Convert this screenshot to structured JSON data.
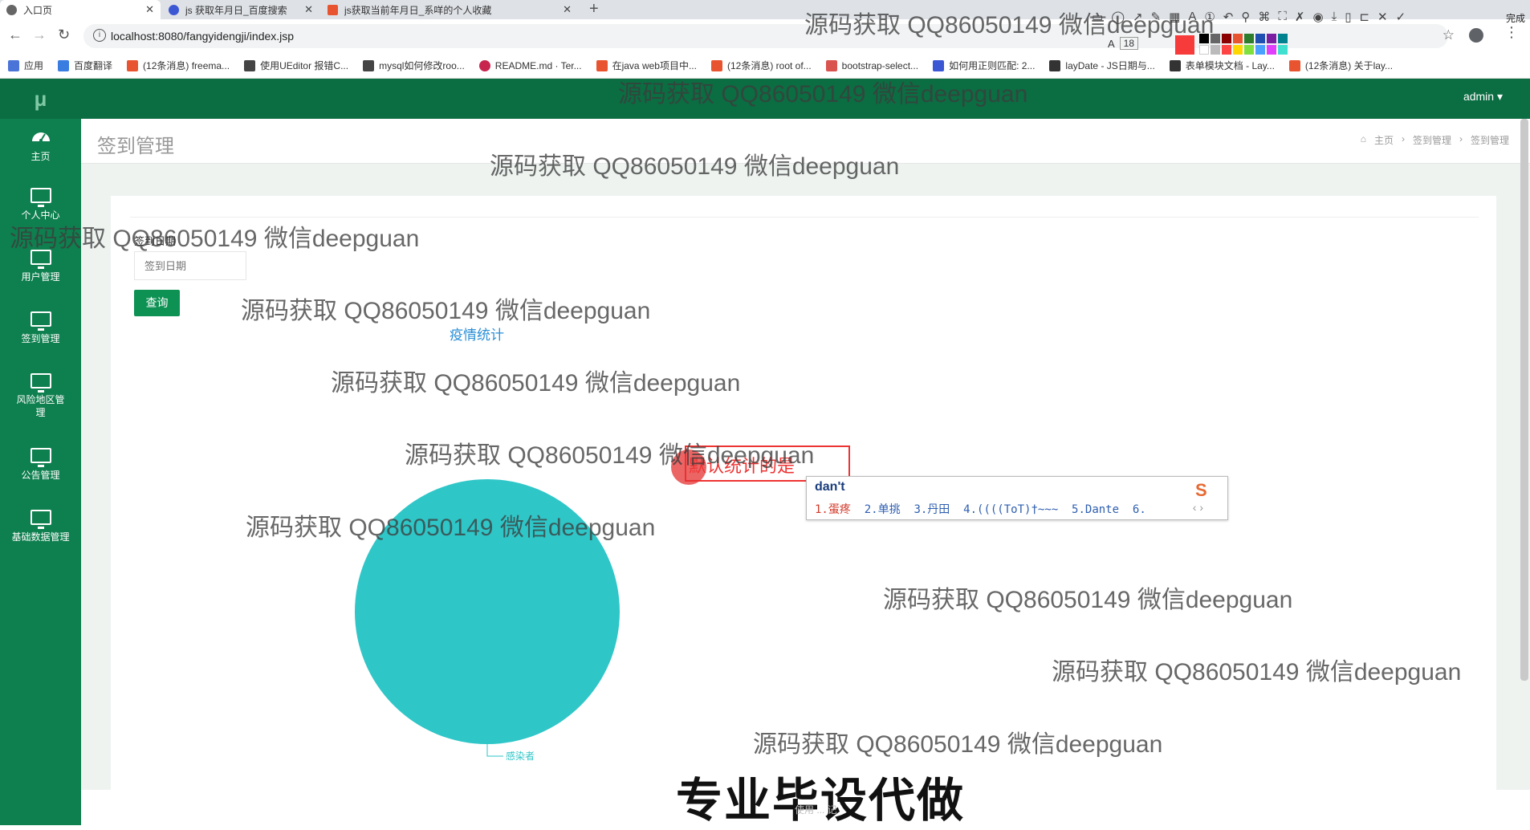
{
  "browser": {
    "tabs": [
      {
        "title": "入口页",
        "active": true
      },
      {
        "title": "js 获取年月日_百度搜索",
        "active": false
      },
      {
        "title": "js获取当前年月日_系咩的个人收藏",
        "active": false
      }
    ],
    "url": "localhost:8080/fangyidengji/index.jsp",
    "bookmarks": [
      "应用",
      "百度翻译",
      "(12条消息) freema...",
      "使用UEditor 报错C...",
      "mysql如何修改roo...",
      "README.md · Ter...",
      "在java web项目中...",
      "(12条消息) root of...",
      "bootstrap-select...",
      "如何用正则匹配: 2...",
      "layDate - JS日期与...",
      "表单模块文档 - Lay...",
      "(12条消息) 关于lay..."
    ],
    "annotation_toolbar": {
      "done_label": "完成",
      "font_size": "18",
      "current_color": "#f73a3a"
    }
  },
  "app": {
    "logo": "μ",
    "admin": "admin ▾",
    "sidebar": [
      {
        "label": "主页",
        "icon": "dashboard-icon"
      },
      {
        "label": "个人中心",
        "icon": "monitor-icon"
      },
      {
        "label": "用户管理",
        "icon": "monitor-icon"
      },
      {
        "label": "签到管理",
        "icon": "monitor-icon"
      },
      {
        "label": "风险地区管理",
        "icon": "monitor-icon"
      },
      {
        "label": "公告管理",
        "icon": "monitor-icon"
      },
      {
        "label": "基础数据管理",
        "icon": "monitor-icon"
      }
    ],
    "page_title": "签到管理",
    "breadcrumb": [
      "主页",
      "签到管理",
      "签到管理"
    ],
    "search": {
      "label": "签到日期",
      "placeholder": "签到日期",
      "button": "查询"
    },
    "chart": {
      "title": "疫情统计"
    }
  },
  "chart_data": {
    "type": "pie",
    "title": "疫情统计",
    "slices": [
      {
        "name": "感染者",
        "value": 100,
        "color": "#2fc6c8"
      }
    ]
  },
  "ime": {
    "composition": "dan't",
    "candidates": [
      "1.蛋疼",
      "2.单挑",
      "3.丹田",
      "4.((((ToT)†~~~",
      "5.Dante",
      "6."
    ]
  },
  "annotation": {
    "text": "默认统计的是"
  },
  "watermarks": {
    "text": "源码获取 QQ86050149 微信deepguan",
    "banner": "专业毕设代做",
    "footer_faint": "使用 ... 记"
  }
}
